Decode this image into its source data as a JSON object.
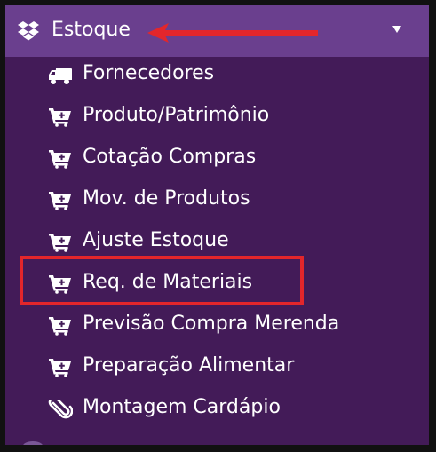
{
  "header": {
    "title": "Estoque",
    "icon": "dropbox-icon",
    "caret": "caret-down-icon"
  },
  "menu": {
    "items": [
      {
        "label": "Fornecedores",
        "icon": "truck-icon"
      },
      {
        "label": "Produto/Patrimônio",
        "icon": "cart-plus-icon"
      },
      {
        "label": "Cotação Compras",
        "icon": "cart-plus-icon"
      },
      {
        "label": "Mov. de Produtos",
        "icon": "cart-plus-icon"
      },
      {
        "label": "Ajuste Estoque",
        "icon": "cart-plus-icon"
      },
      {
        "label": "Req. de Materiais",
        "icon": "cart-plus-icon",
        "highlighted": true
      },
      {
        "label": "Previsão Compra Merenda",
        "icon": "cart-plus-icon"
      },
      {
        "label": "Preparação Alimentar",
        "icon": "cart-plus-icon"
      },
      {
        "label": "Montagem Cardápio",
        "icon": "paperclip-icon"
      }
    ]
  },
  "colors": {
    "sidebar_bg": "#431b58",
    "header_bg": "#6a3f8e",
    "text": "#ffffff",
    "annotation": "#e3262b",
    "frame": "#111111"
  }
}
